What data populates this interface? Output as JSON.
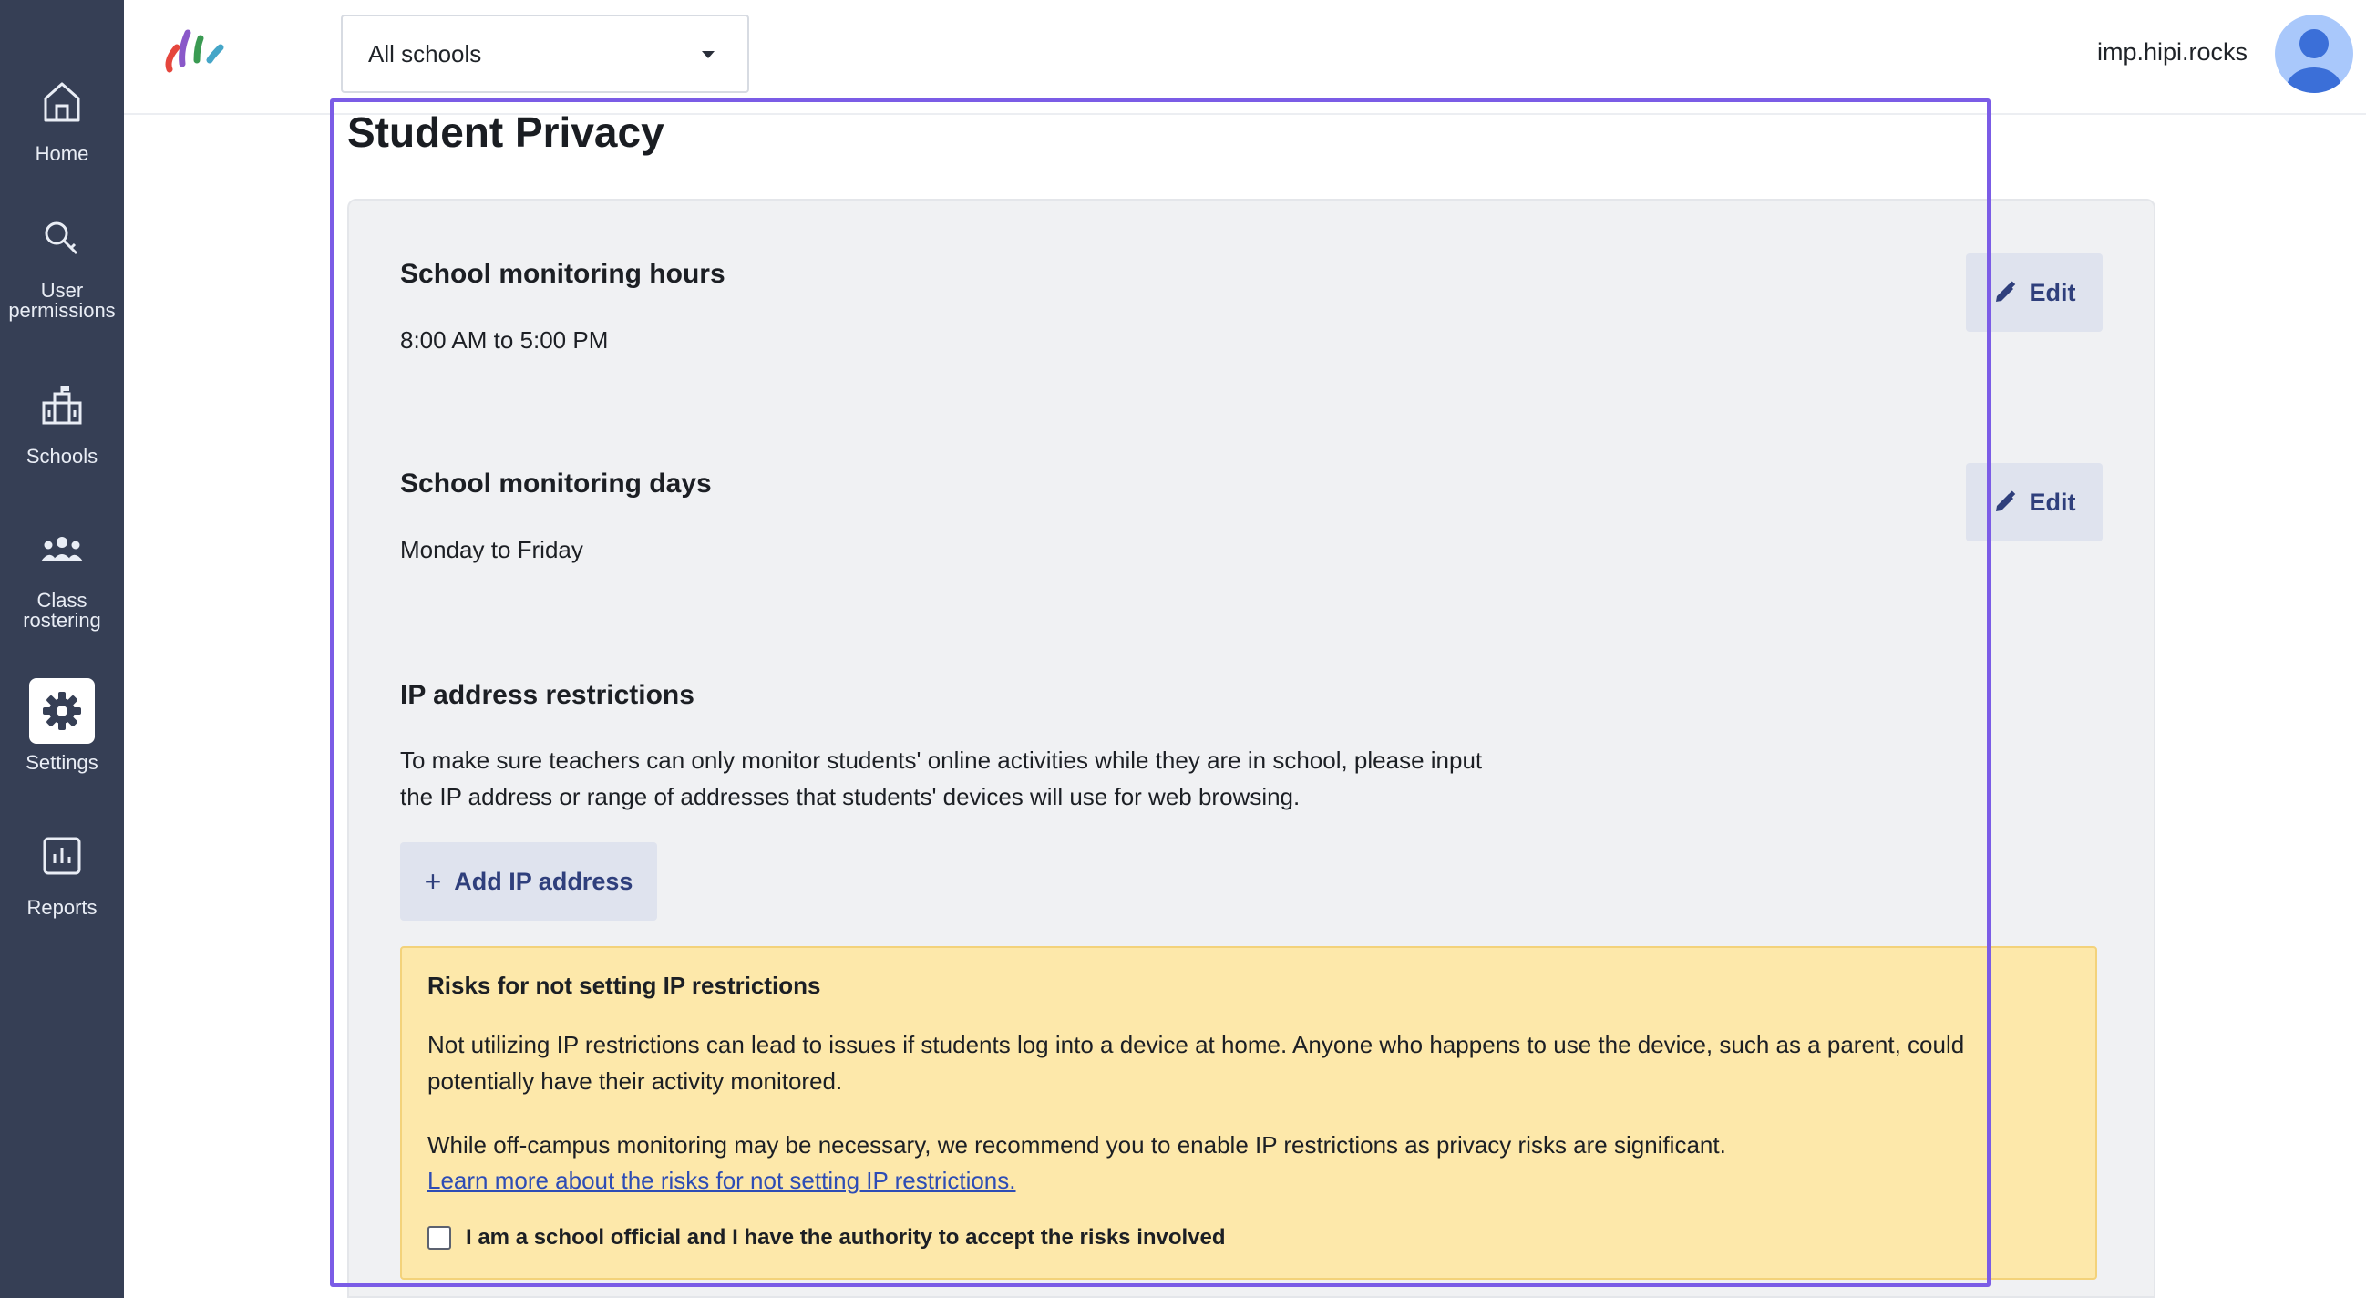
{
  "sidebar": {
    "items": [
      {
        "label": "Home",
        "icon": "home-icon"
      },
      {
        "label": "User permissions",
        "icon": "key-icon"
      },
      {
        "label": "Schools",
        "icon": "school-building-icon"
      },
      {
        "label": "Class rostering",
        "icon": "group-icon"
      },
      {
        "label": "Settings",
        "icon": "gear-icon",
        "active": true
      },
      {
        "label": "Reports",
        "icon": "report-chart-icon"
      }
    ]
  },
  "header": {
    "school_select": "All schools",
    "username": "imp.hipi.rocks"
  },
  "page": {
    "title": "Student Privacy"
  },
  "hours": {
    "title": "School monitoring hours",
    "value": "8:00 AM to 5:00 PM",
    "edit_label": "Edit"
  },
  "days": {
    "title": "School monitoring days",
    "value": "Monday to Friday",
    "edit_label": "Edit"
  },
  "ip": {
    "title": "IP address restrictions",
    "description": "To make sure teachers can only monitor students' online activities while they are in school, please input the IP address or range of addresses that students' devices will use for web browsing.",
    "add_label": "Add IP address",
    "warning": {
      "title": "Risks for not setting IP restrictions",
      "paragraph1": "Not utilizing IP restrictions can lead to issues if students log into a device at home. Anyone who happens to use the device, such as a parent, could potentially have their activity monitored.",
      "paragraph2": "While off-campus monitoring may be necessary, we recommend you to enable IP restrictions as privacy risks are significant.",
      "link": "Learn more about the risks for not setting IP restrictions.",
      "checkbox_label": "I am a school official and I have the authority to accept the risks involved",
      "checkbox_checked": false
    }
  },
  "colors": {
    "sidebar_bg": "#363f55",
    "accent": "#2f3f7c",
    "focus_frame": "#7b5ce6",
    "warning_bg": "#fde8aa"
  }
}
